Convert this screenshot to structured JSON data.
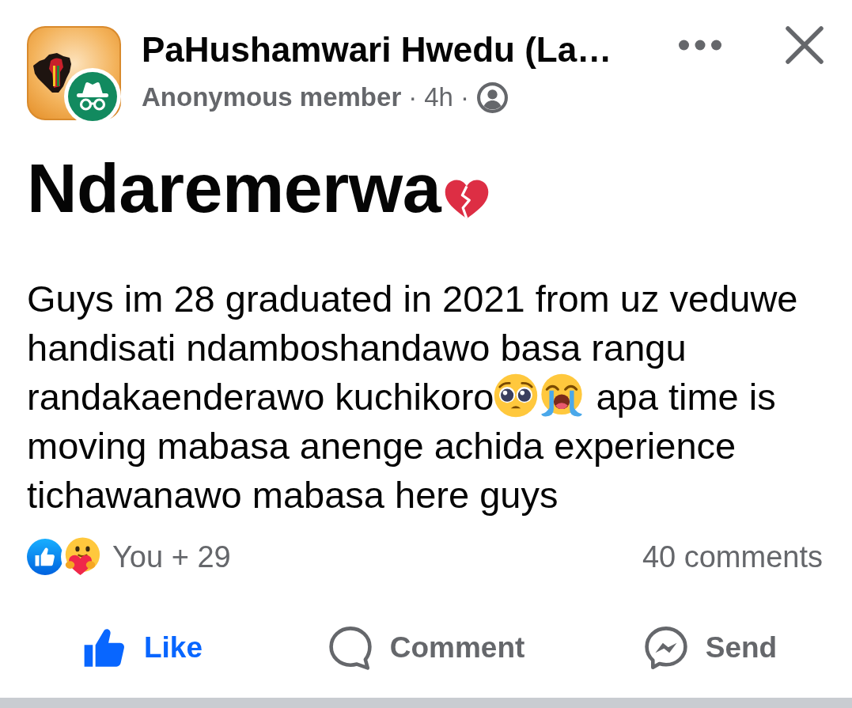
{
  "post_header": {
    "group_name": "PaHushamwari Hwedu (La…",
    "author": "Anonymous member",
    "separator_1": "·",
    "time": "4h",
    "separator_2": "·"
  },
  "post": {
    "title": "Ndaremerwa",
    "body_segments": [
      "Guys im 28 graduated in 2021 from uz veduwe handisati ndamboshandawo basa rangu randakaenderawo kuchikoro",
      "apa time is moving mabasa anenge achida experience tichawanawo mabasa here guys"
    ]
  },
  "reactions": {
    "summary": "You + 29",
    "comments": "40 comments"
  },
  "actions": [
    {
      "kind": "like",
      "label": "Like",
      "active": true
    },
    {
      "kind": "comment",
      "label": "Comment",
      "active": false
    },
    {
      "kind": "send",
      "label": "Send",
      "active": false
    }
  ]
}
